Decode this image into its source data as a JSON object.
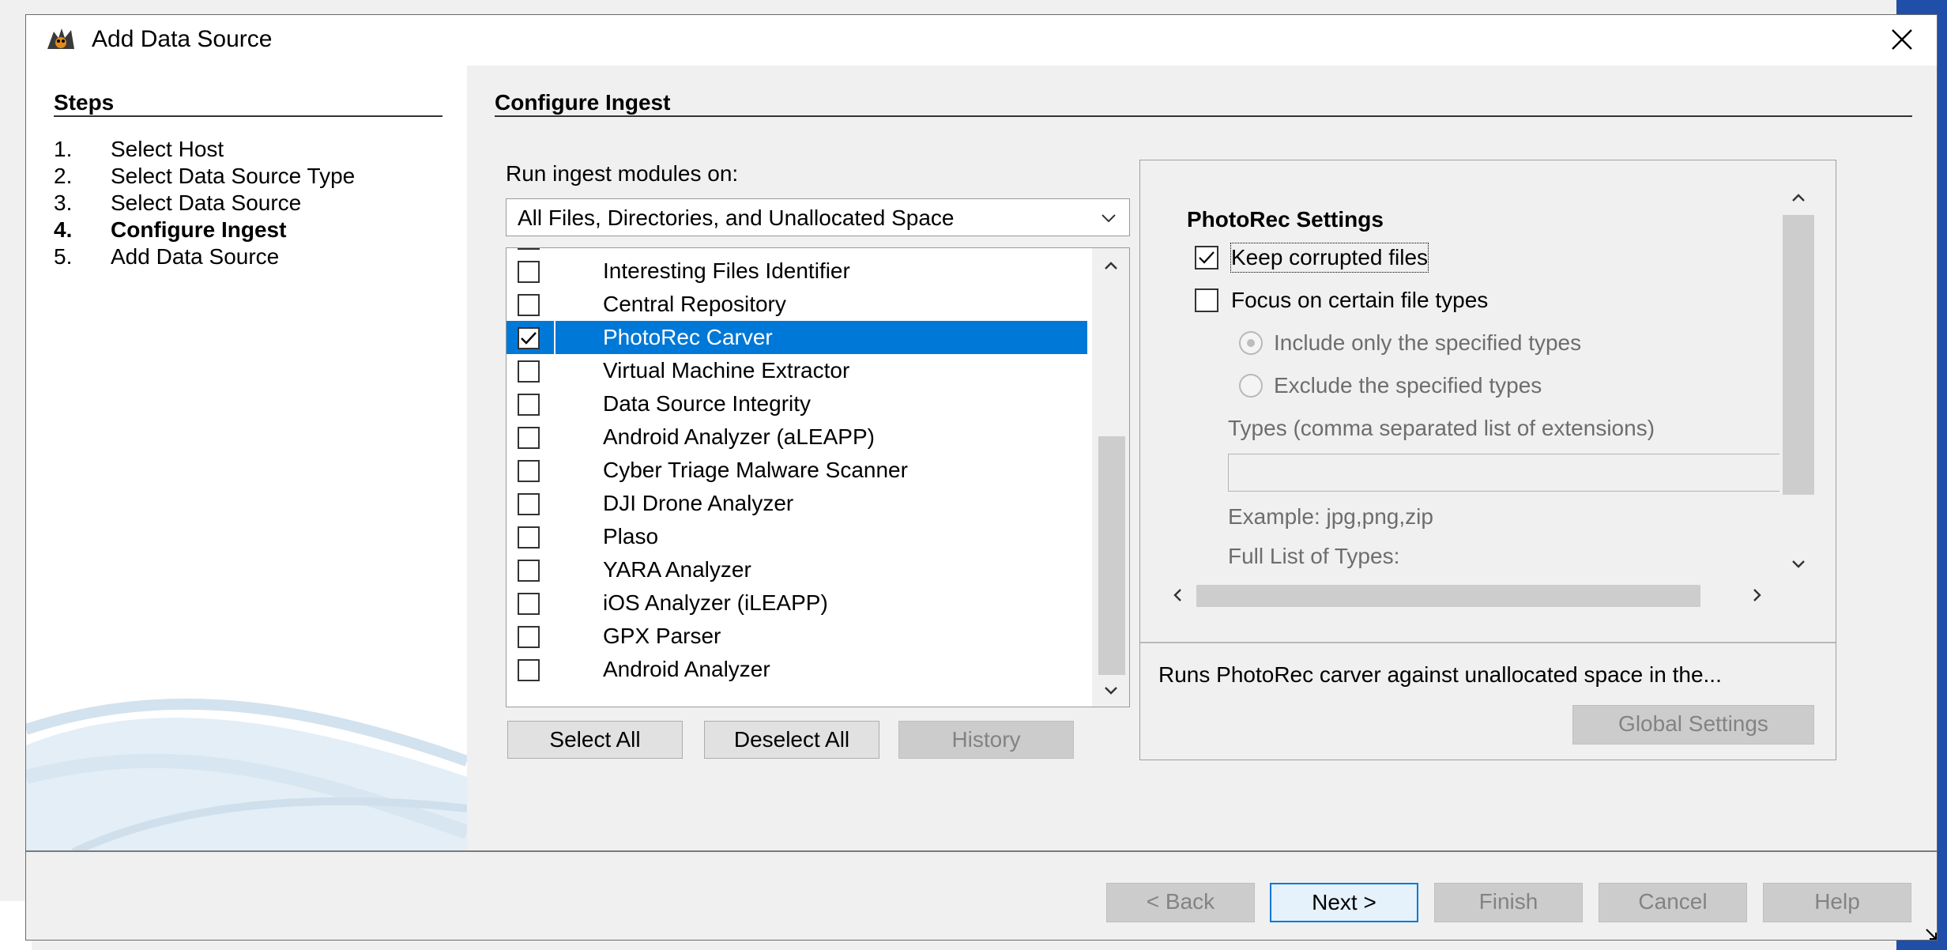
{
  "window": {
    "title": "Add Data Source",
    "close_label": "✕"
  },
  "steps": {
    "heading": "Steps",
    "items": [
      {
        "num": "1.",
        "label": "Select Host",
        "current": false
      },
      {
        "num": "2.",
        "label": "Select Data Source Type",
        "current": false
      },
      {
        "num": "3.",
        "label": "Select Data Source",
        "current": false
      },
      {
        "num": "4.",
        "label": "Configure Ingest",
        "current": true
      },
      {
        "num": "5.",
        "label": "Add Data Source",
        "current": false
      }
    ]
  },
  "configure": {
    "heading": "Configure Ingest",
    "run_on_label": "Run ingest modules on:",
    "run_on_value": "All Files, Directories, and Unallocated Space",
    "modules": [
      {
        "label": "Interesting Files Identifier",
        "checked": false,
        "selected": false
      },
      {
        "label": "Central Repository",
        "checked": false,
        "selected": false
      },
      {
        "label": "PhotoRec Carver",
        "checked": true,
        "selected": true
      },
      {
        "label": "Virtual Machine Extractor",
        "checked": false,
        "selected": false
      },
      {
        "label": "Data Source Integrity",
        "checked": false,
        "selected": false
      },
      {
        "label": "Android Analyzer (aLEAPP)",
        "checked": false,
        "selected": false
      },
      {
        "label": "Cyber Triage Malware Scanner",
        "checked": false,
        "selected": false
      },
      {
        "label": "DJI Drone Analyzer",
        "checked": false,
        "selected": false
      },
      {
        "label": "Plaso",
        "checked": false,
        "selected": false
      },
      {
        "label": "YARA Analyzer",
        "checked": false,
        "selected": false
      },
      {
        "label": "iOS Analyzer (iLEAPP)",
        "checked": false,
        "selected": false
      },
      {
        "label": "GPX Parser",
        "checked": false,
        "selected": false
      },
      {
        "label": "Android Analyzer",
        "checked": false,
        "selected": false
      }
    ],
    "buttons": {
      "select_all": "Select All",
      "deselect_all": "Deselect All",
      "history": "History"
    }
  },
  "settings": {
    "title": "PhotoRec Settings",
    "keep_corrupted": {
      "label": "Keep corrupted files",
      "checked": true
    },
    "focus_types": {
      "label": "Focus on certain file types",
      "checked": false
    },
    "include_only": {
      "label": "Include only the specified types",
      "selected": true
    },
    "exclude": {
      "label": "Exclude the specified types",
      "selected": false
    },
    "types_label": "Types (comma separated list of extensions)",
    "types_value": "",
    "example": "Example: jpg,png,zip",
    "full_list": "Full List of Types:",
    "description": "Runs PhotoRec carver against unallocated space in the...",
    "global_settings": "Global Settings"
  },
  "footer": {
    "back": "< Back",
    "next": "Next >",
    "finish": "Finish",
    "cancel": "Cancel",
    "help": "Help"
  },
  "colors": {
    "selection": "#0078d7",
    "default_button_border": "#0078d7"
  }
}
